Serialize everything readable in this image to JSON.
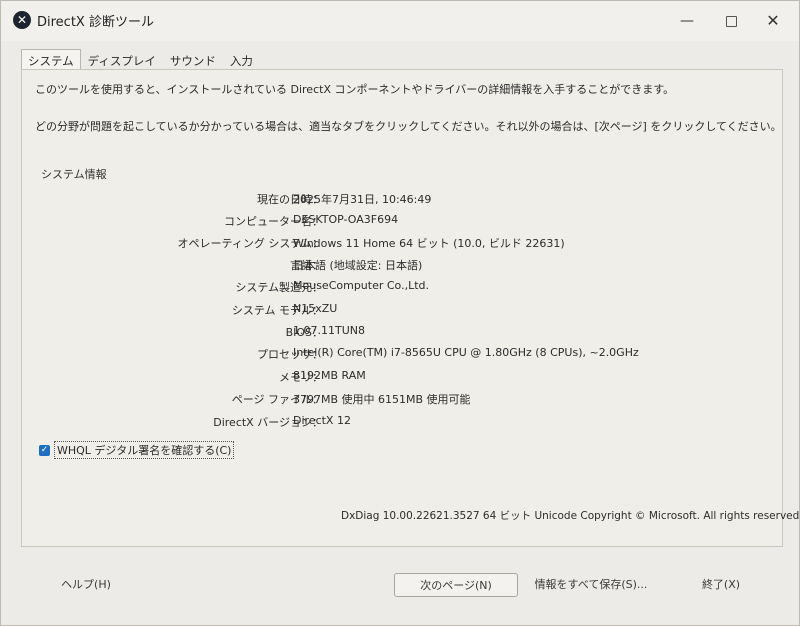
{
  "window": {
    "title": "DirectX 診断ツール",
    "minimize": "—",
    "close": "✕"
  },
  "tabs": [
    {
      "label": "システム"
    },
    {
      "label": "ディスプレイ"
    },
    {
      "label": "サウンド"
    },
    {
      "label": "入力"
    }
  ],
  "intro": {
    "line1": "このツールを使用すると、インストールされている DirectX コンポーネントやドライバーの詳細情報を入手することができます。",
    "line2": "どの分野が問題を起こしているか分かっている場合は、適当なタブをクリックしてください。それ以外の場合は、[次ページ] をクリックしてください。"
  },
  "system_info": {
    "group_label": "システム情報",
    "rows": [
      {
        "key": "現在の日時：",
        "value": "2025年7月31日, 10:46:49"
      },
      {
        "key": "コンピューター名：",
        "value": "DESKTOP-OA3F694"
      },
      {
        "key": "オペレーティング システム：",
        "value": "Windows 11 Home 64 ビット (10.0, ビルド 22631)"
      },
      {
        "key": "言語：",
        "value": "日本語 (地域設定: 日本語)"
      },
      {
        "key": "システム製造元：",
        "value": "MouseComputer Co.,Ltd."
      },
      {
        "key": "システム モデル：",
        "value": "N15xZU"
      },
      {
        "key": "BIOS：",
        "value": "1.07.11TUN8"
      },
      {
        "key": "プロセッサ：",
        "value": "Intel(R) Core(TM) i7-8565U CPU @ 1.80GHz (8 CPUs), ~2.0GHz"
      },
      {
        "key": "メモリ：",
        "value": "8192MB RAM"
      },
      {
        "key": "ページ ファイル：",
        "value": "3797MB 使用中 6151MB 使用可能"
      },
      {
        "key": "DirectX バージョン：",
        "value": "DirectX 12"
      }
    ]
  },
  "whql": {
    "label": "WHQL デジタル署名を確認する(C)",
    "checked": true
  },
  "footer_info": "DxDiag 10.00.22621.3527 64 ビット Unicode  Copyright © Microsoft. All rights reserved.",
  "buttons": {
    "help": "ヘルプ(H)",
    "next": "次のページ(N)",
    "save": "情報をすべて保存(S)...",
    "exit": "終了(X)"
  }
}
